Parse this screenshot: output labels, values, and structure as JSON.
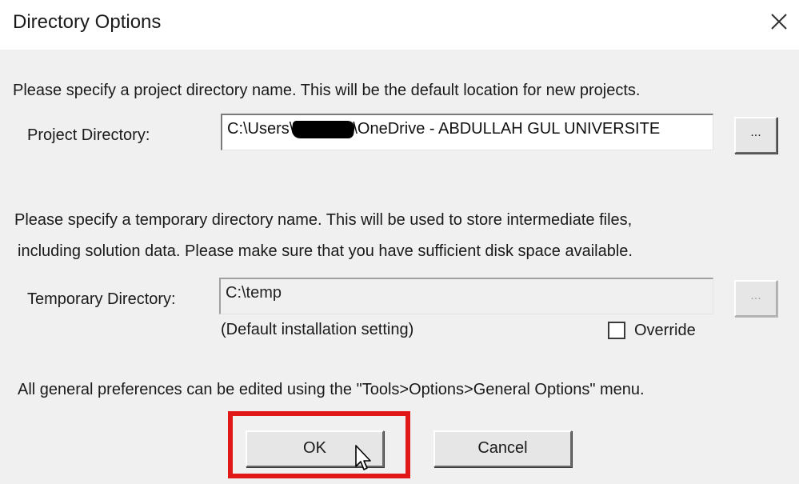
{
  "dialog": {
    "title": "Directory Options",
    "close_icon": "close-icon"
  },
  "project": {
    "description": "Please specify a project directory name. This will be the default location for new projects.",
    "label": "Project Directory:",
    "value_prefix": "C:\\Users\\",
    "value_suffix": "\\OneDrive - ABDULLAH GUL UNIVERSITE",
    "browse_label": "..."
  },
  "temporary": {
    "description_line1": "Please specify a temporary directory name. This will be used to store intermediate files,",
    "description_line2": "including solution data. Please make sure that you have sufficient disk space available.",
    "label": "Temporary Directory:",
    "value": "C:\\temp",
    "browse_label": "...",
    "note": "(Default installation setting)",
    "override_label": "Override",
    "override_checked": false
  },
  "footer": {
    "note": "All general preferences can be edited using the \"Tools>Options>General Options\" menu."
  },
  "buttons": {
    "ok_label": "OK",
    "cancel_label": "Cancel"
  },
  "annotation": {
    "highlight_color": "#e01818"
  }
}
